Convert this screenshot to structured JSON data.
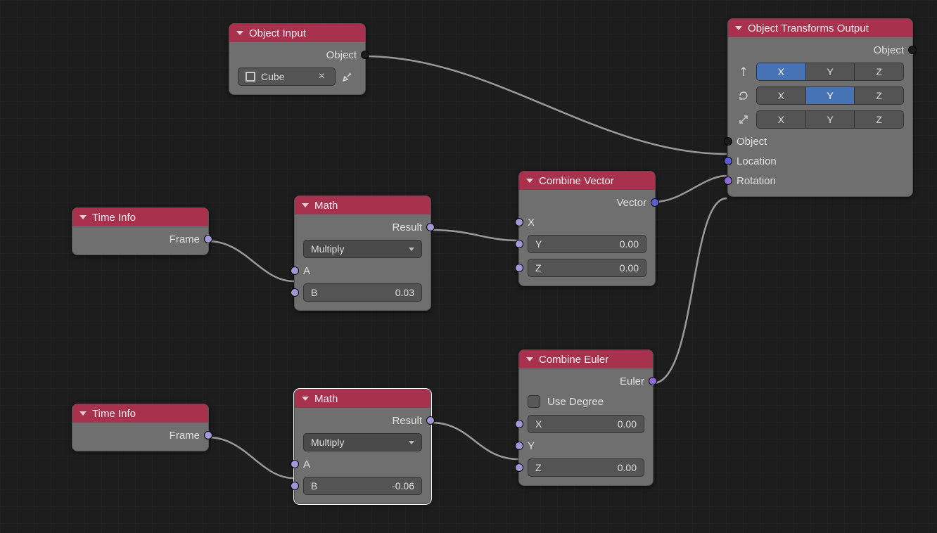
{
  "nodes": {
    "objectInput": {
      "title": "Object Input",
      "outputs": {
        "object": "Object"
      },
      "picker": {
        "value": "Cube"
      }
    },
    "timeInfo1": {
      "title": "Time Info",
      "outputs": {
        "frame": "Frame"
      }
    },
    "timeInfo2": {
      "title": "Time Info",
      "outputs": {
        "frame": "Frame"
      }
    },
    "math1": {
      "title": "Math",
      "outputs": {
        "result": "Result"
      },
      "operation": "Multiply",
      "inputs": {
        "a": "A",
        "b": {
          "label": "B",
          "value": "0.03"
        }
      }
    },
    "math2": {
      "title": "Math",
      "outputs": {
        "result": "Result"
      },
      "operation": "Multiply",
      "inputs": {
        "a": "A",
        "b": {
          "label": "B",
          "value": "-0.06"
        }
      }
    },
    "combineVector": {
      "title": "Combine Vector",
      "outputs": {
        "vector": "Vector"
      },
      "inputs": {
        "x": "X",
        "y": {
          "label": "Y",
          "value": "0.00"
        },
        "z": {
          "label": "Z",
          "value": "0.00"
        }
      }
    },
    "combineEuler": {
      "title": "Combine Euler",
      "outputs": {
        "euler": "Euler"
      },
      "useDegree": "Use Degree",
      "inputs": {
        "x": {
          "label": "X",
          "value": "0.00"
        },
        "y": "Y",
        "z": {
          "label": "Z",
          "value": "0.00"
        }
      }
    },
    "objectTransformsOutput": {
      "title": "Object Transforms Output",
      "outputs": {
        "object": "Object"
      },
      "axisRows": {
        "location": {
          "x": "X",
          "y": "Y",
          "z": "Z",
          "active": "X"
        },
        "rotation": {
          "x": "X",
          "y": "Y",
          "z": "Z",
          "active": "Y"
        },
        "scale": {
          "x": "X",
          "y": "Y",
          "z": "Z",
          "active": ""
        }
      },
      "inputs": {
        "object": "Object",
        "location": "Location",
        "rotation": "Rotation"
      }
    }
  }
}
